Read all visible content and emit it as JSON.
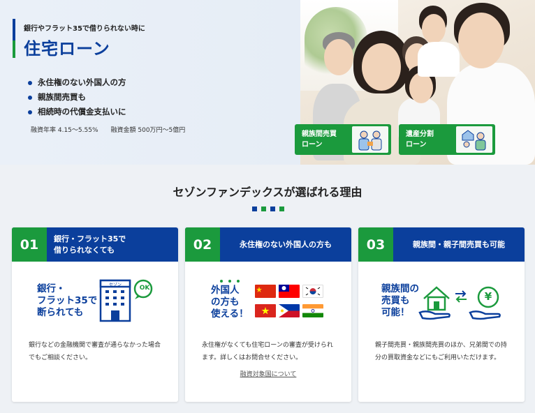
{
  "hero": {
    "subtitle": "銀行やフラット35で借りられない時に",
    "title": "住宅ローン",
    "bullets": [
      "永住権のない外国人の方",
      "親族間売買も",
      "相続時の代償金支払いに"
    ],
    "rate": "融資年率 4.15〜5.55%",
    "amount": "融資金額 500万円〜5億円",
    "buttons": [
      {
        "line1": "親族間売買",
        "line2": "ローン"
      },
      {
        "line1": "遺産分割",
        "line2": "ローン"
      }
    ]
  },
  "section": {
    "title": "セゾンファンデックスが選ばれる理由"
  },
  "reasons": [
    {
      "number": "01",
      "heading_line1": "銀行・フラット35で",
      "heading_line2": "借りられなくても",
      "illus_line1": "銀行・",
      "illus_line2": "フラット35で",
      "illus_line3": "断られても",
      "building_label": "セゾン",
      "badge": "OK",
      "desc": "銀行などの金融機関で審査が通らなかった場合でもご相談ください。"
    },
    {
      "number": "02",
      "heading": "永住権のない外国人の方も",
      "illus_line1": "外国人",
      "illus_line2": "の方も",
      "illus_line3": "使える！",
      "desc": "永住権がなくても住宅ローンの審査が受けられます。詳しくはお問合せください。",
      "link": "融資対象国について"
    },
    {
      "number": "03",
      "heading": "親族間・親子間売買も可能",
      "illus_line1": "親族間の",
      "illus_line2": "売買も",
      "illus_line3": "可能！",
      "yen": "¥",
      "desc": "親子間売買・親族間売買のほか、兄弟間での持分の買取資金などにもご利用いただけます。"
    }
  ],
  "colors": {
    "navy": "#0b3f9c",
    "green": "#1b9a3d"
  },
  "icons": [
    "building-icon",
    "ok-bubble-icon",
    "flag-china",
    "flag-taiwan",
    "flag-korea",
    "flag-vietnam",
    "flag-philippines",
    "flag-india",
    "house-hand-icon",
    "exchange-arrows-icon",
    "yen-hand-icon"
  ]
}
